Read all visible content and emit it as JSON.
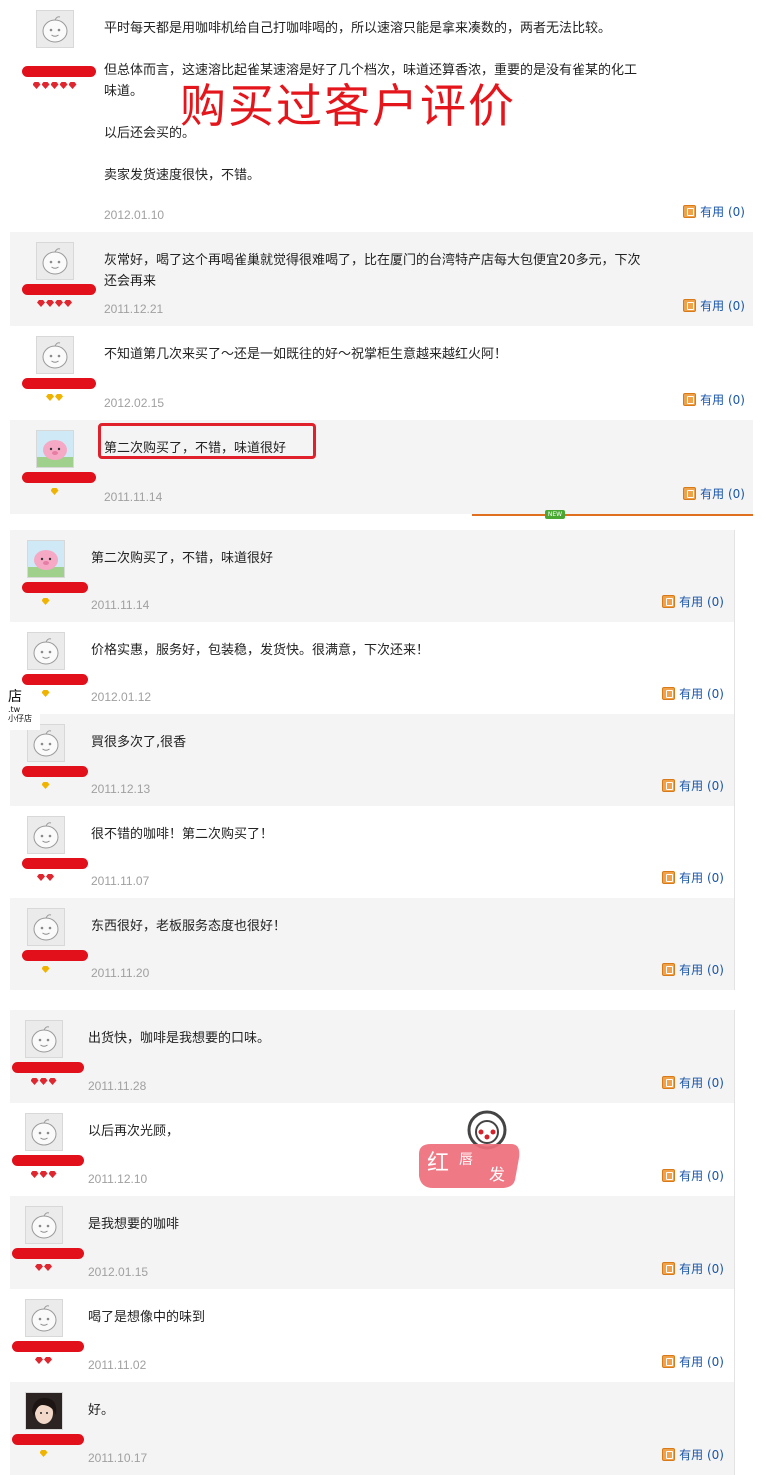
{
  "overlay": {
    "title": "购买过客户评价",
    "watermark_text": "红唇发",
    "side_tag": {
      "main": "店",
      "line2": ".tw",
      "line3": "小仔店"
    },
    "new_badge": "NEW"
  },
  "useful_label": "有用 (0)",
  "groups": [
    {
      "reviews": [
        {
          "text": "平时每天都是用咖啡机给自己打咖啡喝的，所以速溶只能是拿来凑数的，两者无法比较。\n\n但总体而言，这速溶比起雀某速溶是好了几个档次，味道还算香浓，重要的是没有雀某的化工\n味道。\n\n以后还会买的。\n\n卖家发货速度很快，不错。",
          "date": "2012.01.10",
          "useful": "有用 (0)",
          "gems": 5,
          "gem_color": "red",
          "avatar": "default"
        },
        {
          "text": "灰常好，喝了这个再喝雀巢就觉得很难喝了，比在厦门的台湾特产店每大包便宜20多元，下次\n还会再来",
          "date": "2011.12.21",
          "useful": "有用 (0)",
          "gems": 4,
          "gem_color": "red",
          "avatar": "default"
        },
        {
          "text": "不知道第几次来买了～还是一如既往的好～祝掌柜生意越来越红火阿！",
          "date": "2012.02.15",
          "useful": "有用 (0)",
          "gems": 2,
          "gem_color": "gold",
          "avatar": "default"
        },
        {
          "text": "第二次购买了，不错，味道很好",
          "date": "2011.11.14",
          "useful": "有用 (0)",
          "gems": 1,
          "gem_color": "gold",
          "avatar": "pink"
        }
      ]
    },
    {
      "reviews": [
        {
          "text": "第二次购买了，不错，味道很好",
          "date": "2011.11.14",
          "useful": "有用 (0)",
          "gems": 1,
          "gem_color": "gold",
          "avatar": "pink"
        },
        {
          "text": "价格实惠，服务好，包装稳，发货快。很满意，下次还来！",
          "date": "2012.01.12",
          "useful": "有用 (0)",
          "gems": 1,
          "gem_color": "gold",
          "avatar": "default"
        },
        {
          "text": "買很多次了,很香",
          "date": "2011.12.13",
          "useful": "有用 (0)",
          "gems": 1,
          "gem_color": "gold",
          "avatar": "default"
        },
        {
          "text": "很不错的咖啡！第二次购买了！",
          "date": "2011.11.07",
          "useful": "有用 (0)",
          "gems": 2,
          "gem_color": "red",
          "avatar": "default"
        },
        {
          "text": "东西很好，老板服务态度也很好！",
          "date": "2011.11.20",
          "useful": "有用 (0)",
          "gems": 1,
          "gem_color": "gold",
          "avatar": "default"
        }
      ]
    },
    {
      "reviews": [
        {
          "text": "出货快，咖啡是我想要的口味。",
          "date": "2011.11.28",
          "useful": "有用 (0)",
          "gems": 3,
          "gem_color": "red",
          "avatar": "default"
        },
        {
          "text": "以后再次光顾，",
          "date": "2011.12.10",
          "useful": "有用 (0)",
          "gems": 3,
          "gem_color": "red",
          "avatar": "default"
        },
        {
          "text": "是我想要的咖啡",
          "date": "2012.01.15",
          "useful": "有用 (0)",
          "gems": 2,
          "gem_color": "red",
          "avatar": "default"
        },
        {
          "text": "喝了是想像中的味到",
          "date": "2011.11.02",
          "useful": "有用 (0)",
          "gems": 2,
          "gem_color": "red",
          "avatar": "default"
        },
        {
          "text": "好。",
          "date": "2011.10.17",
          "useful": "有用 (0)",
          "gems": 1,
          "gem_color": "gold",
          "avatar": "photo"
        }
      ]
    }
  ]
}
